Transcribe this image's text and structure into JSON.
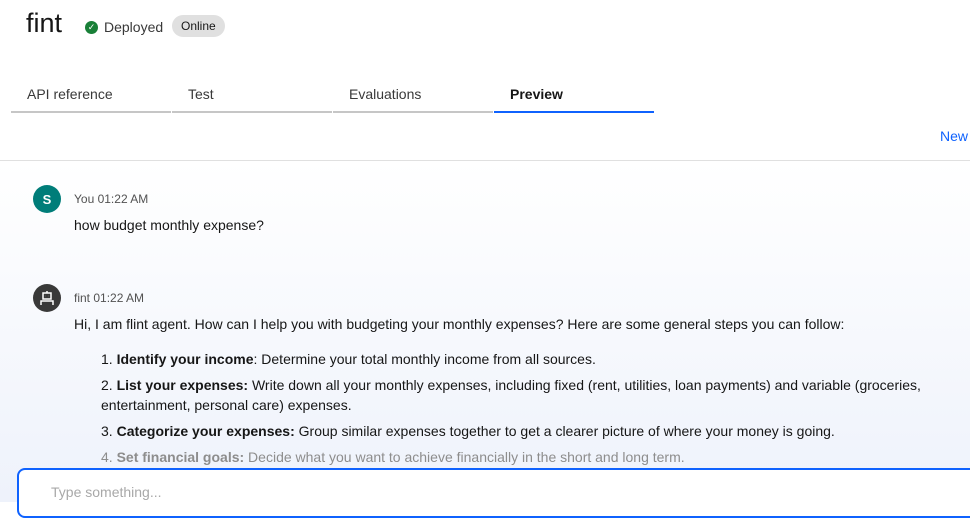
{
  "header": {
    "title": "fint",
    "status": "Deployed",
    "badge": "Online"
  },
  "tabs": [
    {
      "label": "API reference"
    },
    {
      "label": "Test"
    },
    {
      "label": "Evaluations"
    },
    {
      "label": "Preview",
      "active": true
    }
  ],
  "new_label": "New",
  "messages": [
    {
      "avatar": "S",
      "sender": "You 01:22 AM",
      "text": "how budget monthly expense?"
    },
    {
      "avatar_icon": "robot-icon",
      "sender": "fint 01:22 AM",
      "text": "Hi, I am flint agent. How can I help you with budgeting your monthly expenses? Here are some general steps you can follow:",
      "steps": [
        {
          "n": "1.",
          "title": "Identify your income",
          "text": ": Determine your total monthly income from all sources."
        },
        {
          "n": "2.",
          "title": "List your expenses:",
          "text": " Write down all your monthly expenses, including fixed (rent, utilities, loan payments) and variable (groceries, entertainment, personal care) expenses."
        },
        {
          "n": "3.",
          "title": "Categorize your expenses:",
          "text": " Group similar expenses together to get a clearer picture of where your money is going."
        },
        {
          "n": "4.",
          "title": "Set financial goals:",
          "text": " Decide what you want to achieve financially in the short and long term."
        }
      ]
    }
  ],
  "input": {
    "placeholder": "Type something..."
  },
  "colors": {
    "accent": "#0f62fe",
    "user_avatar": "#007d79",
    "bot_avatar": "#393939",
    "success": "#198038"
  }
}
